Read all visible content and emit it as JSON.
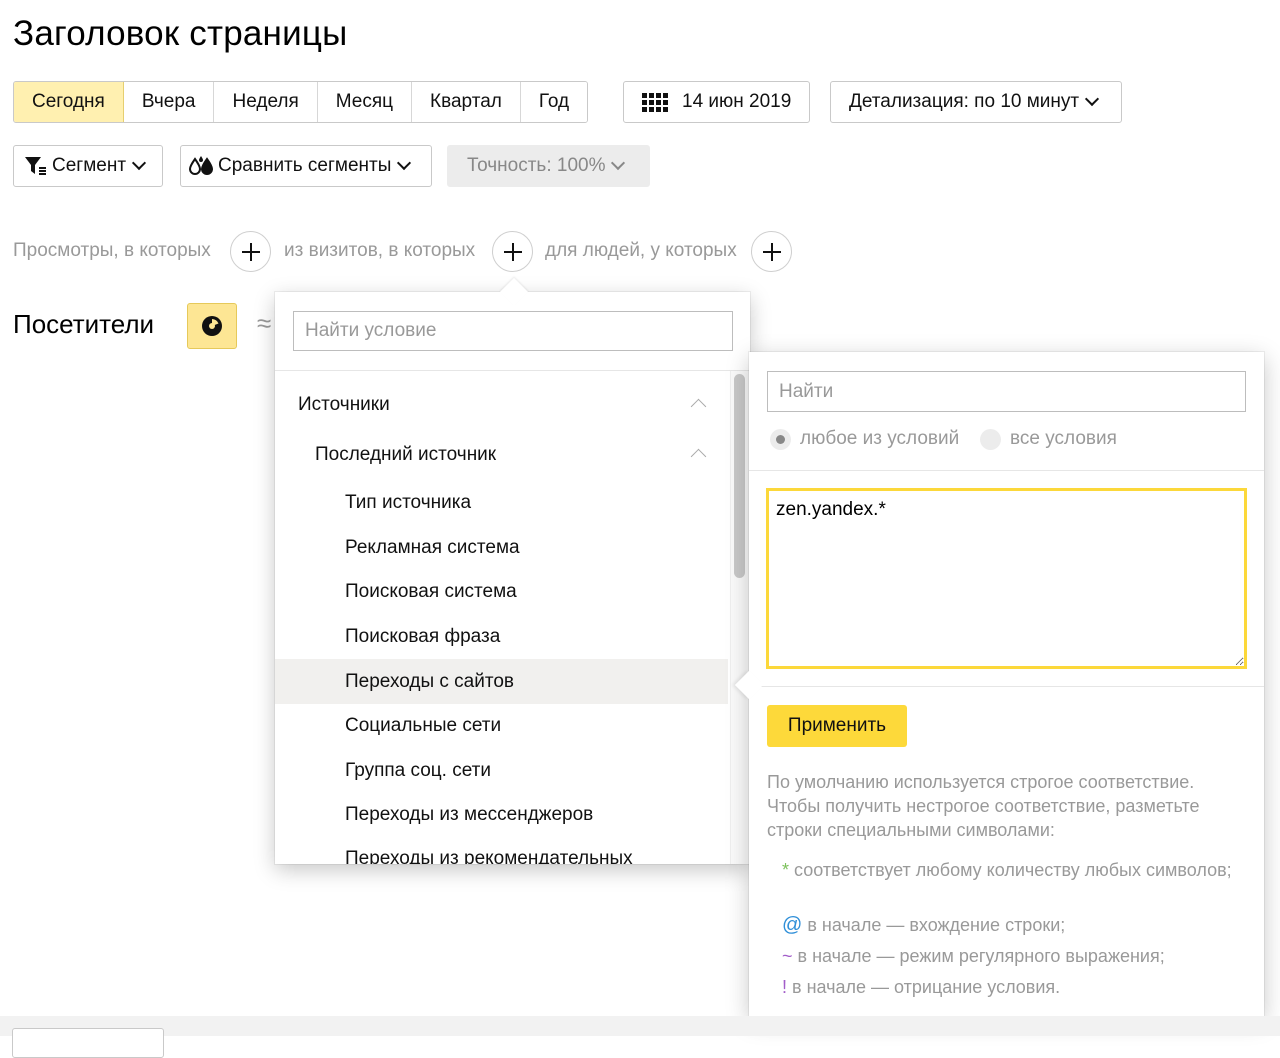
{
  "page": {
    "title": "Заголовок страницы"
  },
  "periods": {
    "items": [
      "Сегодня",
      "Вчера",
      "Неделя",
      "Месяц",
      "Квартал",
      "Год"
    ],
    "selected": "Сегодня"
  },
  "date_button": {
    "label": "14 июн 2019",
    "icon": "calendar-icon"
  },
  "detail_button": {
    "label": "Детализация: по 10 минут"
  },
  "segment_button": {
    "label": "Сегмент",
    "icon": "funnel-icon"
  },
  "compare_button": {
    "label": "Сравнить сегменты",
    "icon": "drops-icon"
  },
  "accuracy_button": {
    "label": "Точность: 100%"
  },
  "conditions": {
    "views_label": "Просмотры, в которых",
    "visits_label": "из визитов, в которых",
    "people_label": "для людей, у которых"
  },
  "visitors": {
    "title": "Посетители",
    "approx": "≈"
  },
  "dropdown": {
    "search_placeholder": "Найти условие",
    "items": [
      {
        "label": "Источники",
        "expanded": true
      },
      {
        "label": "Последний источник",
        "expanded": true
      },
      {
        "label": "Тип источника"
      },
      {
        "label": "Рекламная система"
      },
      {
        "label": "Поисковая система"
      },
      {
        "label": "Поисковая фраза"
      },
      {
        "label": "Переходы с сайтов",
        "highlighted": true
      },
      {
        "label": "Социальные сети"
      },
      {
        "label": "Группа соц. сети"
      },
      {
        "label": "Переходы из мессенджеров"
      },
      {
        "label": "Переходы из рекомендательных"
      }
    ]
  },
  "panel": {
    "search_placeholder": "Найти",
    "radio_any": "любое из условий",
    "radio_all": "все условия",
    "radio_selected": "any",
    "textarea_value": "zen.yandex.*",
    "apply_label": "Применить",
    "hint_text": "По умолчанию используется строгое соответствие. Чтобы получить нестрогое соответствие, разметьте строки специальными символами:",
    "hints": [
      {
        "symbol": "*",
        "text": " соответствует любому количеству любых символов;"
      },
      {
        "symbol": "@",
        "text": " в начале — вхождение строки;"
      },
      {
        "symbol": "~",
        "text": " в начале — режим регулярного выражения;"
      },
      {
        "symbol": "!",
        "text": " в начале — отрицание условия."
      }
    ]
  },
  "colors": {
    "accent_yellow": "#fdd93a",
    "selected_period_bg": "#fff0b0",
    "textarea_border": "#fcd83a",
    "muted_text": "#999999"
  }
}
